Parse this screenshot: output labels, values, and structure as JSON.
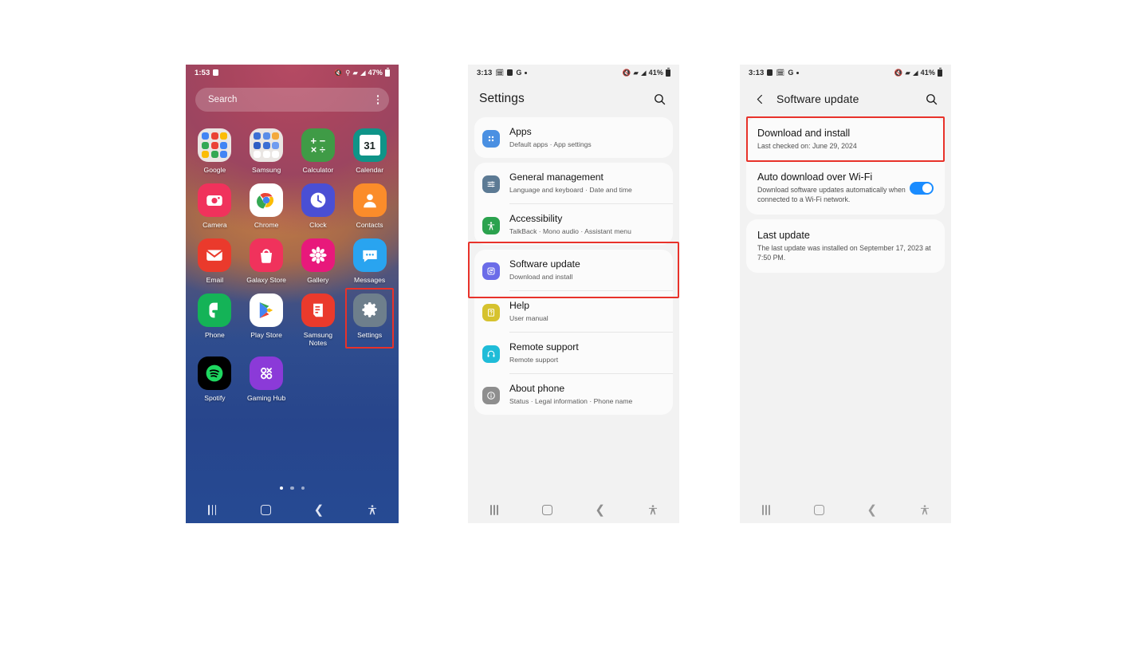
{
  "home_screen": {
    "status_bar": {
      "time": "1:53",
      "battery_percent": "47%",
      "icons": [
        "mute-icon",
        "location-icon",
        "wifi-icon",
        "signal-icon",
        "battery-icon"
      ]
    },
    "search": {
      "placeholder": "Search",
      "menu_icon": "kebab-menu-icon"
    },
    "apps": [
      {
        "label": "Google",
        "icon": "google-folder-icon",
        "type": "folder",
        "colors": [
          "#4285f4",
          "#ea4335",
          "#fbbc05",
          "#34a853",
          "#ea4335",
          "#4285f4",
          "#fbbc05",
          "#34a853",
          "#4285f4"
        ]
      },
      {
        "label": "Samsung",
        "icon": "samsung-folder-icon",
        "type": "folder",
        "colors": [
          "#3b6fd4",
          "#5a8de8",
          "#f3a93c",
          "#2f5fc4",
          "#3b6fd4",
          "#6f9bf0",
          "#ffffff",
          "#ffffff",
          "#ffffff"
        ]
      },
      {
        "label": "Calculator",
        "icon": "calculator-icon",
        "type": "glyph",
        "color": "#3f9b46",
        "glyph": "+−\n×÷"
      },
      {
        "label": "Calendar",
        "icon": "calendar-icon",
        "type": "glyph",
        "color": "#0f9488",
        "glyph": "31"
      },
      {
        "label": "Camera",
        "icon": "camera-icon",
        "type": "glyph",
        "color": "#f0325c",
        "glyph": ""
      },
      {
        "label": "Chrome",
        "icon": "chrome-icon",
        "type": "glyph",
        "color": "#ffffff",
        "glyph": ""
      },
      {
        "label": "Clock",
        "icon": "clock-icon",
        "type": "glyph",
        "color": "#4a4fd4",
        "glyph": ""
      },
      {
        "label": "Contacts",
        "icon": "contacts-icon",
        "type": "glyph",
        "color": "#fb8c2a",
        "glyph": ""
      },
      {
        "label": "Email",
        "icon": "email-icon",
        "type": "glyph",
        "color": "#ea3a2c",
        "glyph": ""
      },
      {
        "label": "Galaxy Store",
        "icon": "galaxy-store-icon",
        "type": "glyph",
        "color": "#f0325c",
        "glyph": ""
      },
      {
        "label": "Gallery",
        "icon": "gallery-icon",
        "type": "glyph",
        "color": "#e8197b",
        "glyph": ""
      },
      {
        "label": "Messages",
        "icon": "messages-icon",
        "type": "glyph",
        "color": "#29a4f0",
        "glyph": ""
      },
      {
        "label": "Phone",
        "icon": "phone-icon",
        "type": "glyph",
        "color": "#14b357",
        "glyph": ""
      },
      {
        "label": "Play Store",
        "icon": "play-store-icon",
        "type": "glyph",
        "color": "#ffffff",
        "glyph": ""
      },
      {
        "label": "Samsung Notes",
        "icon": "samsung-notes-icon",
        "type": "glyph",
        "color": "#ea3a2c",
        "glyph": ""
      },
      {
        "label": "Settings",
        "icon": "settings-gear-icon",
        "type": "glyph",
        "color": "#6e7f8c",
        "glyph": "",
        "selected": true
      },
      {
        "label": "Spotify",
        "icon": "spotify-icon",
        "type": "glyph",
        "color": "#000000",
        "glyph": ""
      },
      {
        "label": "Gaming Hub",
        "icon": "gaming-hub-icon",
        "type": "glyph",
        "color": "#8b3ad8",
        "glyph": ""
      }
    ],
    "page_dots": {
      "count": 3,
      "active_index": 0
    },
    "nav_bar": {
      "recents": "recents-icon",
      "home": "home-icon",
      "back": "back-icon",
      "accessibility": "accessibility-icon"
    }
  },
  "settings_screen": {
    "status_bar": {
      "time": "3:13",
      "battery_percent": "41%",
      "icons": [
        "calendar-icon",
        "gallery-icon",
        "google-icon",
        "dot-icon",
        "mute-icon",
        "wifi-icon",
        "signal-icon",
        "battery-icon"
      ]
    },
    "title": "Settings",
    "search_icon": "search-icon",
    "items": [
      {
        "title": "Apps",
        "subtitle": "Default apps  ·  App settings",
        "icon": "apps-grid-icon",
        "color": "#4a90e2",
        "group": 0
      },
      {
        "title": "General management",
        "subtitle": "Language and keyboard  ·  Date and time",
        "icon": "sliders-icon",
        "color": "#5c7a94",
        "group": 1
      },
      {
        "title": "Accessibility",
        "subtitle": "TalkBack  ·  Mono audio  ·  Assistant menu",
        "icon": "accessibility-icon",
        "color": "#2ba24e",
        "group": 1
      },
      {
        "title": "Software update",
        "subtitle": "Download and install",
        "icon": "software-update-icon",
        "color": "#6b6ce8",
        "group": 2,
        "selected": true
      },
      {
        "title": "Help",
        "subtitle": "User manual",
        "icon": "help-book-icon",
        "color": "#d6c22e",
        "group": 2
      },
      {
        "title": "Remote support",
        "subtitle": "Remote support",
        "icon": "headset-icon",
        "color": "#1fbcd8",
        "group": 2
      },
      {
        "title": "About phone",
        "subtitle": "Status  ·  Legal information  ·  Phone name",
        "icon": "info-circle-icon",
        "color": "#8e8e8e",
        "group": 2
      }
    ],
    "nav_bar": {
      "recents": "recents-icon",
      "home": "home-icon",
      "back": "back-icon",
      "accessibility": "accessibility-icon"
    }
  },
  "software_update_screen": {
    "status_bar": {
      "time": "3:13",
      "battery_percent": "41%",
      "icons": [
        "gallery-icon",
        "calendar-icon",
        "google-icon",
        "dot-icon",
        "mute-icon",
        "wifi-icon",
        "signal-icon",
        "battery-icon"
      ]
    },
    "back_icon": "back-arrow-icon",
    "title": "Software update",
    "search_icon": "search-icon",
    "items": [
      {
        "title": "Download and install",
        "subtitle": "Last checked on: June 29, 2024",
        "selected": true,
        "toggle": null
      },
      {
        "title": "Auto download over Wi-Fi",
        "subtitle": "Download software updates automatically when connected to a Wi-Fi network.",
        "selected": false,
        "toggle": "on"
      },
      {
        "title": "Last update",
        "subtitle": "The last update was installed on September 17, 2023 at 7:50 PM.",
        "selected": false,
        "toggle": null
      }
    ],
    "nav_bar": {
      "recents": "recents-icon",
      "home": "home-icon",
      "back": "back-icon",
      "accessibility": "accessibility-icon"
    }
  },
  "highlight_color": "#e8322a",
  "toggle_on_color": "#1a8cff"
}
